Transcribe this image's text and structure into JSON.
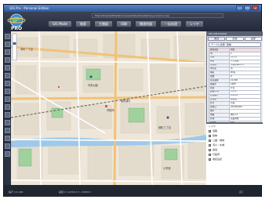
{
  "window": {
    "title": "GIS Pro - Personal Edition",
    "buttons": [
      "_",
      "□",
      "×"
    ]
  },
  "header": {
    "logo_text": "PRO",
    "address": "Map\\GIS\\data\\PROJ\\Windows\\GIS\\Desktop\\Net\\Layer\\demo.map",
    "menu": [
      "GIS Mode",
      "検索",
      "主題図",
      "印刷",
      "関連地図",
      "一括処理",
      "レイヤ"
    ]
  },
  "map": {
    "labels": [
      "本町一丁目",
      "中央公園",
      "市役所",
      "駅前通り",
      "緑町三丁目",
      "小学校"
    ],
    "colors": {
      "land": "#eee6d8",
      "block": "#e3dccd",
      "park": "#9fd19d",
      "water": "#9ec9ea",
      "major_road": "#f0c27a",
      "road": "#ffffff",
      "railway": "#6e6e6e"
    }
  },
  "panel": {
    "header": "GIS Information",
    "tabs": [
      "属性",
      "関連",
      "画像"
    ],
    "table_select": "テーブル名称: 建物",
    "rows": [
      [
        "属性項目",
        "内容"
      ],
      [
        "ID",
        "1"
      ],
      [
        "名称",
        "市庁舎"
      ],
      [
        "種別",
        "公共施設"
      ],
      [
        "所在地",
        "中央区本町1-1"
      ],
      [
        "所有者",
        "市"
      ],
      [
        "構造",
        "RC造"
      ],
      [
        "階数",
        "8"
      ],
      [
        "延床面積",
        "12,500"
      ],
      [
        "建築年",
        "1985"
      ],
      [
        "用途",
        "庁舎"
      ],
      [
        "面積(m2)",
        "3,250"
      ],
      [
        "管理番号",
        "A-0012"
      ],
      [
        "管理者",
        "総務課"
      ],
      [
        "区分",
        "行政"
      ],
      [
        "更新日",
        "2010/04/01"
      ],
      [
        "備考",
        ""
      ],
      [
        "地番",
        "本町1-1"
      ],
      [
        "区域",
        "商業地域"
      ],
      [
        "容積率",
        "600"
      ],
      [
        "建ぺい率",
        "80"
      ],
      [
        "用途地域",
        "商業"
      ],
      [
        "地区",
        "中央"
      ],
      [
        "調査",
        "済"
      ]
    ],
    "buttons": [
      "編集",
      "保存"
    ]
  },
  "layers": {
    "title": "レイヤ",
    "items": [
      "道路",
      "建物",
      "公園・緑地",
      "河川・水域",
      "鉄道",
      "行政界",
      "地名注記"
    ]
  },
  "status": {
    "left": "縮尺 1/1,000",
    "middle": "座標 X: 12345.6 Y: -23456.7",
    "right": "完了"
  }
}
